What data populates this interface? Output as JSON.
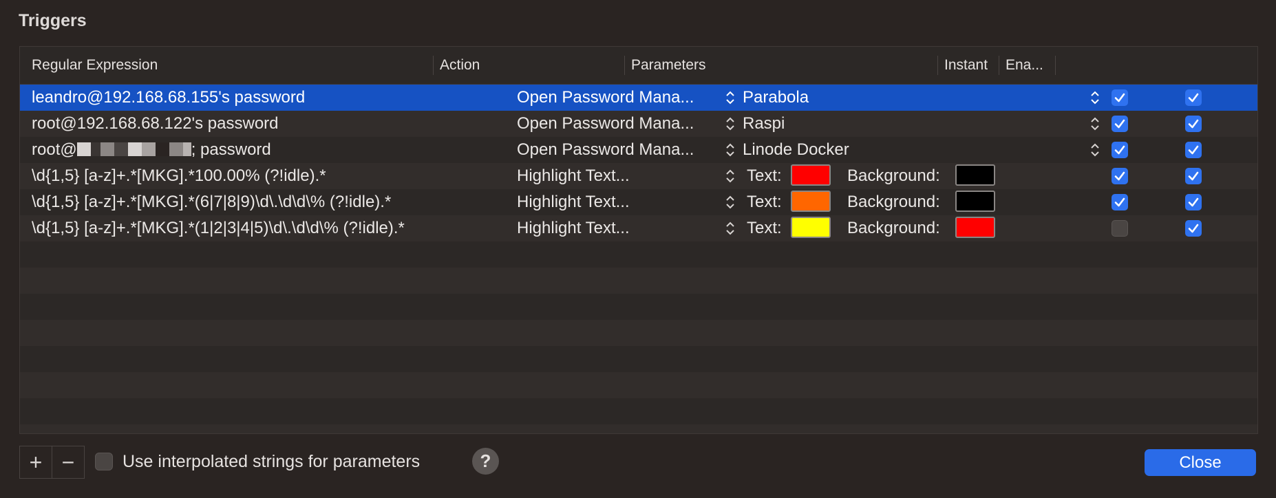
{
  "window": {
    "title": "Triggers"
  },
  "table": {
    "columns": {
      "regex": "Regular Expression",
      "action": "Action",
      "parameters": "Parameters",
      "instant": "Instant",
      "enabled": "Ena..."
    },
    "rows": [
      {
        "regex": "leandro@192.168.68.155's password",
        "action": "Open Password Mana...",
        "param": "Parabola",
        "instant": true,
        "enabled": true,
        "selected": true
      },
      {
        "regex": "root@192.168.68.122's password",
        "action": "Open Password Mana...",
        "param": "Raspi",
        "instant": true,
        "enabled": true
      },
      {
        "regex_prefix": "root@",
        "regex_suffix": "; password",
        "action": "Open Password Mana...",
        "param": "Linode Docker",
        "instant": true,
        "enabled": true
      },
      {
        "regex": "\\d{1,5} [a-z]+.*[MKG].*100.00% (?!idle).*",
        "action": "Highlight Text...",
        "text_label": "Text:",
        "text_color": "#ff0000",
        "bg_label": "Background:",
        "bg_color": "#000000",
        "instant": true,
        "enabled": true
      },
      {
        "regex": "\\d{1,5} [a-z]+.*[MKG].*(6|7|8|9)\\d\\.\\d\\d\\% (?!idle).*",
        "action": "Highlight Text...",
        "text_label": "Text:",
        "text_color": "#ff6600",
        "bg_label": "Background:",
        "bg_color": "#000000",
        "instant": true,
        "enabled": true
      },
      {
        "regex": "\\d{1,5} [a-z]+.*[MKG].*(1|2|3|4|5)\\d\\.\\d\\d\\% (?!idle).*",
        "action": "Highlight Text...",
        "text_label": "Text:",
        "text_color": "#ffff00",
        "bg_label": "Background:",
        "bg_color": "#ff0000",
        "instant": false,
        "enabled": true
      }
    ]
  },
  "footer": {
    "add_symbol": "+",
    "remove_symbol": "−",
    "interpolated_label": "Use interpolated strings for parameters",
    "interpolated_checked": false,
    "help_symbol": "?",
    "close_label": "Close"
  },
  "colors": {
    "selection": "#1652c3",
    "checkbox_on": "#2f72f0",
    "close_button": "#2a6be8"
  }
}
